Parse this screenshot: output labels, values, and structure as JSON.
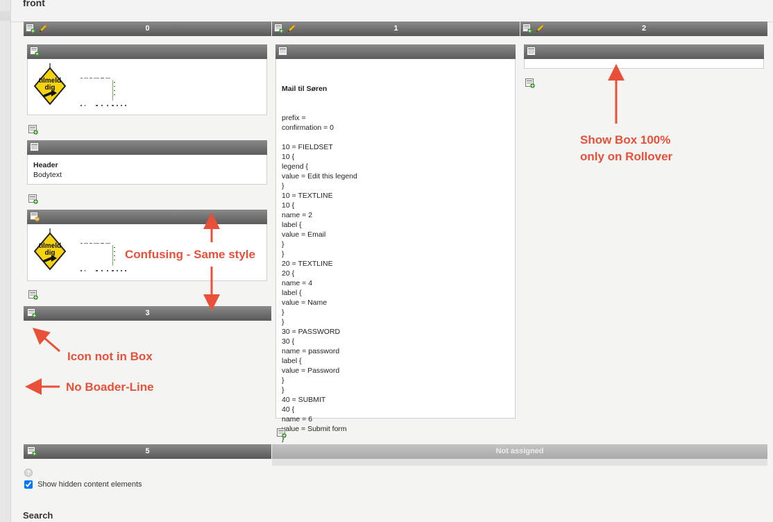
{
  "page": {
    "title": "front"
  },
  "columns": [
    {
      "label": "0"
    },
    {
      "label": "1"
    },
    {
      "label": "2"
    },
    {
      "label": "3"
    },
    {
      "label": "5"
    }
  ],
  "not_assigned": "Not assigned",
  "text_element": {
    "header": "Header",
    "body": "Bodytext"
  },
  "mail_element": {
    "title": "Mail til Søren",
    "lines": [
      "prefix =",
      "confirmation = 0",
      "",
      "10 = FIELDSET",
      "10 {",
      "legend {",
      "value = Edit this legend",
      "}",
      "10 = TEXTLINE",
      "10 {",
      "name = 2",
      "label {",
      "value = Email",
      "}",
      "}",
      "20 = TEXTLINE",
      "20 {",
      "name = 4",
      "label {",
      "value = Name",
      "}",
      "}",
      "30 = PASSWORD",
      "30 {",
      "name = password",
      "label {",
      "value = Password",
      "}",
      "}",
      "40 = SUBMIT",
      "40 {",
      "name = 6",
      "value = Submit form",
      "}",
      "}"
    ]
  },
  "annotations": {
    "confusing": "Confusing - Same style",
    "show_box_1": "Show Box 100%",
    "show_box_2": "only on Rollover",
    "icon_not_in_box": "Icon not in Box",
    "no_border": "No Boader-Line"
  },
  "sign_text": {
    "line1": "tilmeld",
    "line2": "dig"
  },
  "options": {
    "show_hidden_label": "Show hidden content elements",
    "show_hidden_checked": true
  },
  "search": {
    "label": "Search"
  },
  "colors": {
    "annotation": "#e8503a",
    "header_dark": "#5c5c5c",
    "sign_yellow": "#f5d40f"
  },
  "icons": [
    "new-content-icon",
    "edit-pencil-icon",
    "content-element-icon",
    "image-element-icon",
    "text-element-icon",
    "help-icon",
    "arrow-icon"
  ]
}
